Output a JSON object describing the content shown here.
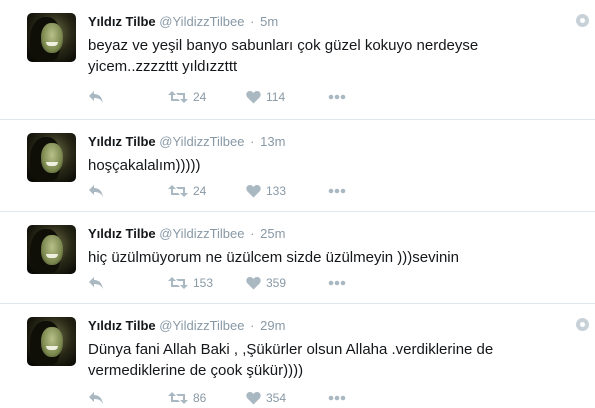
{
  "colors": {
    "text": "#14171a",
    "muted": "#8899a6",
    "border": "#e1e8ed",
    "icon": "#aab8c2"
  },
  "icons": {
    "reply": "reply-icon",
    "retweet": "retweet-icon",
    "like": "heart-icon",
    "more": "more-dots-icon",
    "settings": "gear-icon",
    "avatar": "profile-photo"
  },
  "tweets": [
    {
      "name": "Yıldız Tilbe",
      "handle": "@YildizzTilbee",
      "separator": "·",
      "time": "5m",
      "text": "beyaz ve yeşil banyo sabunları çok güzel kokuyo nerdeyse yicem..zzzzttt yıldızzttt",
      "retweets": "24",
      "likes": "114"
    },
    {
      "name": "Yıldız Tilbe",
      "handle": "@YildizzTilbee",
      "separator": "·",
      "time": "13m",
      "text": "hoşçakalalım)))))",
      "retweets": "24",
      "likes": "133"
    },
    {
      "name": "Yıldız Tilbe",
      "handle": "@YildizzTilbee",
      "separator": "·",
      "time": "25m",
      "text": "hiç üzülmüyorum ne üzülcem  sizde üzülmeyin )))sevinin",
      "retweets": "153",
      "likes": "359"
    },
    {
      "name": "Yıldız Tilbe",
      "handle": "@YildizzTilbee",
      "separator": "·",
      "time": "29m",
      "text": "Dünya fani Allah Baki , ,Şükürler olsun Allaha .verdiklerine de vermediklerine de çook şükür))))",
      "retweets": "86",
      "likes": "354"
    }
  ]
}
